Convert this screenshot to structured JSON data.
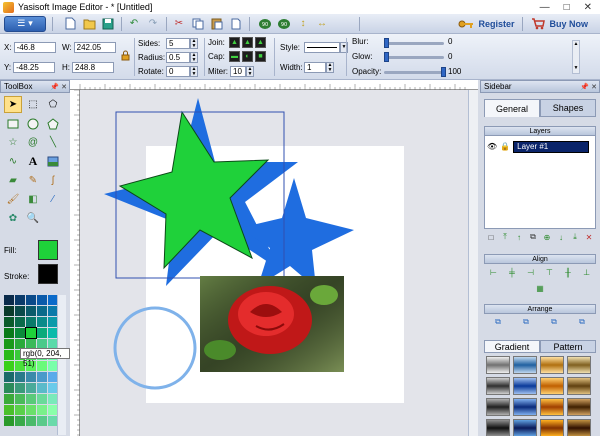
{
  "window": {
    "title": "Yasisoft Image Editor - * [Untitled]",
    "min": "—",
    "max": "□",
    "close": "✕"
  },
  "toolbar": {
    "menu_arrow": "▾",
    "register_label": "Register",
    "buy_label": "Buy Now",
    "icons": [
      "new-icon",
      "open-icon",
      "save-icon",
      "undo-icon",
      "redo-icon",
      "cut-icon",
      "copy-icon",
      "paste-icon",
      "delete-icon",
      "rotate-left-icon",
      "rotate-right-icon",
      "flip-vertical-icon",
      "flip-horizontal-icon"
    ]
  },
  "props": {
    "x_label": "X:",
    "x_value": "-46.8",
    "w_label": "W:",
    "w_value": "242.05",
    "y_label": "Y:",
    "y_value": "-48.25",
    "h_label": "H:",
    "h_value": "248.8",
    "sides_label": "Sides:",
    "sides_value": "5",
    "radius_label": "Radius:",
    "radius_value": "0.5",
    "rotate_label": "Rotate:",
    "rotate_value": "0",
    "join_label": "Join:",
    "cap_label": "Cap:",
    "miter_label": "Miter:",
    "miter_value": "10",
    "style_label": "Style:",
    "width_label": "Width:",
    "width_value": "1",
    "blur_label": "Blur:",
    "blur_value": "0",
    "blur_level": 0,
    "glow_label": "Glow:",
    "glow_value": "0",
    "glow_level": 0,
    "opacity_label": "Opacity:",
    "opacity_value": "100",
    "opacity_level": 100
  },
  "toolbox": {
    "title": "ToolBox",
    "tools": [
      "pointer-icon",
      "node-edit-icon",
      "polygon-select-icon",
      "rectangle-icon",
      "ellipse-icon",
      "pentagon-icon",
      "star-icon",
      "spiral-icon",
      "line-icon",
      "curve-icon",
      "text-icon",
      "image-icon",
      "eraser-icon",
      "pencil-icon",
      "bezier-icon",
      "brush-icon",
      "paint-bucket-icon",
      "eyedropper-icon",
      "gradient-icon",
      "zoom-icon"
    ],
    "fill_label": "Fill:",
    "stroke_label": "Stroke:",
    "fill_color": "#1fd13a",
    "stroke_color": "#000000",
    "tooltip": "rgb(0, 204, 51)"
  },
  "sidebar": {
    "title": "Sidebar",
    "tabs": [
      "General",
      "Shapes"
    ],
    "layers_header": "Layers",
    "layer_name": "Layer #1",
    "align_header": "Align",
    "arrange_header": "Arrange",
    "bottom_tabs": [
      "Gradient",
      "Pattern"
    ]
  }
}
